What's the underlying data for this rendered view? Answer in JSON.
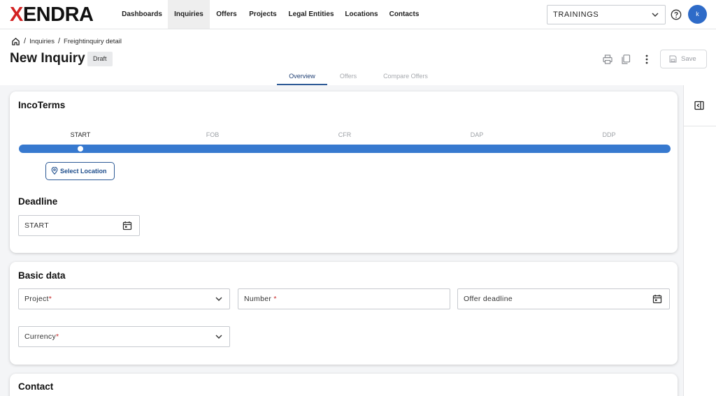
{
  "brand": {
    "logo_x": "X",
    "logo_rest": "ENDRA",
    "accent": "#d32222"
  },
  "nav": [
    {
      "label": "Dashboards",
      "active": false
    },
    {
      "label": "Inquiries",
      "active": true
    },
    {
      "label": "Offers",
      "active": false
    },
    {
      "label": "Projects",
      "active": false
    },
    {
      "label": "Legal Entities",
      "active": false
    },
    {
      "label": "Locations",
      "active": false
    },
    {
      "label": "Contacts",
      "active": false
    }
  ],
  "tenant_select": {
    "value": "TRAININGS"
  },
  "user": {
    "initial": "k",
    "avatar_color": "#2e6bc8"
  },
  "breadcrumb": {
    "items": [
      "Inquiries",
      "Freightinquiry detail"
    ],
    "separator": "/"
  },
  "page": {
    "title": "New Inquiry",
    "status_badge": "Draft",
    "save_label": "Save"
  },
  "tabs": [
    {
      "label": "Overview",
      "active": true
    },
    {
      "label": "Offers",
      "active": false
    },
    {
      "label": "Compare Offers",
      "active": false
    }
  ],
  "incoterms": {
    "title": "IncoTerms",
    "steps": [
      "START",
      "FOB",
      "CFR",
      "DAP",
      "DDP"
    ],
    "active_step": "START",
    "track_color": "#3779cf",
    "select_location_label": "Select Location",
    "deadline_title": "Deadline",
    "deadline_value": "START"
  },
  "basic_data": {
    "title": "Basic data",
    "project_label": "Project",
    "number_label": "Number",
    "offer_deadline_label": "Offer deadline",
    "currency_label": "Currency",
    "required_mark": "*"
  },
  "contact": {
    "title": "Contact"
  }
}
